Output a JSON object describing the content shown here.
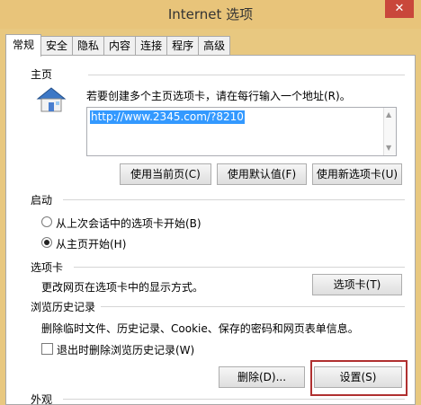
{
  "window": {
    "title": "Internet 选项",
    "close_label": "✕"
  },
  "tabs": [
    "常规",
    "安全",
    "隐私",
    "内容",
    "连接",
    "程序",
    "高级"
  ],
  "home": {
    "section_label": "主页",
    "description": "若要创建多个主页选项卡，请在每行输入一个地址(R)。",
    "url_value": "http://www.2345.com/?8210",
    "buttons": {
      "use_current": "使用当前页(C)",
      "use_default": "使用默认值(F)",
      "use_new_tab": "使用新选项卡(U)"
    }
  },
  "startup": {
    "section_label": "启动",
    "option_last_session": "从上次会话中的选项卡开始(B)",
    "option_home_page": "从主页开始(H)",
    "selected": "option_home_page"
  },
  "tabs_section": {
    "section_label": "选项卡",
    "description": "更改网页在选项卡中的显示方式。",
    "button": "选项卡(T)"
  },
  "history": {
    "section_label": "浏览历史记录",
    "description": "删除临时文件、历史记录、Cookie、保存的密码和网页表单信息。",
    "checkbox_label": "退出时删除浏览历史记录(W)",
    "checkbox_checked": false,
    "delete_button": "删除(D)...",
    "settings_button": "设置(S)"
  },
  "appearance": {
    "section_label": "外观"
  },
  "colors": {
    "title_bar": "#e8c47a",
    "close_button": "#c9473b",
    "selection": "#3399ff",
    "highlight_box": "#b03030"
  },
  "icons": [
    "close-icon",
    "house-icon",
    "radio-button",
    "checkbox"
  ]
}
